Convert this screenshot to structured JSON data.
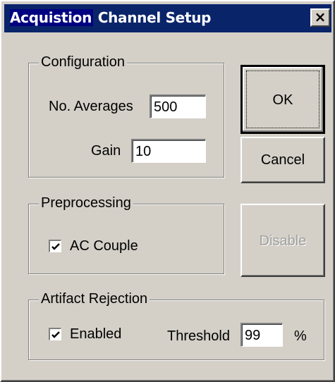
{
  "window": {
    "title_part1": "Acquistion",
    "title_part2": " Channel Setup",
    "close_glyph": "×"
  },
  "configuration": {
    "group_label": "Configuration",
    "averages_label": "No. Averages",
    "averages_value": "500",
    "gain_label": "Gain",
    "gain_value": "10"
  },
  "preprocessing": {
    "group_label": "Preprocessing",
    "ac_couple_label": "AC Couple",
    "ac_couple_checked": true
  },
  "artifact_rejection": {
    "group_label": "Artifact Rejection",
    "enabled_label": "Enabled",
    "enabled_checked": true,
    "threshold_label": "Threshold",
    "threshold_value": "99",
    "unit": "%"
  },
  "buttons": {
    "ok_label": "OK",
    "cancel_label": "Cancel",
    "disable_label": "Disable"
  },
  "colors": {
    "titlebar": "#0a246a",
    "dialog_face": "#d4d0c8"
  }
}
